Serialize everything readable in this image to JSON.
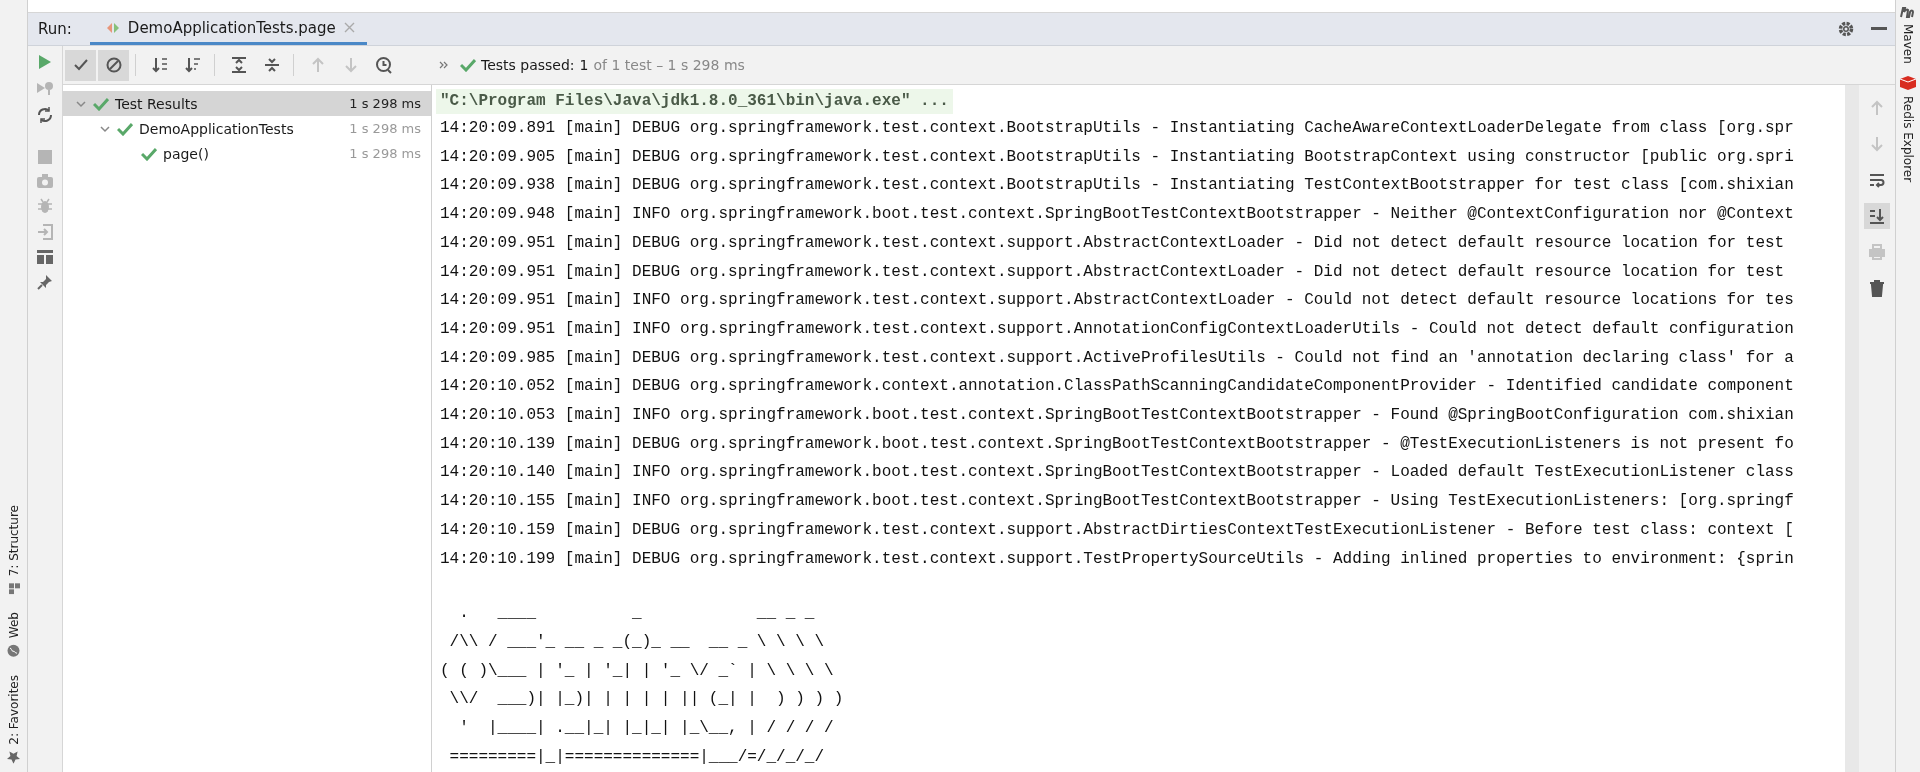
{
  "run_bar": {
    "label": "Run:",
    "tabs": [
      {
        "title": "DemoApplicationTests.page",
        "selected": true
      }
    ]
  },
  "toolbar": [
    {
      "kind": "show-passed",
      "on": true,
      "disabled": false
    },
    {
      "kind": "show-ignored",
      "on": true,
      "disabled": false
    },
    {
      "kind": "sort-alpha",
      "on": false,
      "disabled": false
    },
    {
      "kind": "sort-duration",
      "on": false,
      "disabled": false
    },
    {
      "kind": "expand-all",
      "on": false,
      "disabled": false
    },
    {
      "kind": "collapse-all",
      "on": false,
      "disabled": false
    },
    {
      "kind": "previous",
      "on": false,
      "disabled": true
    },
    {
      "kind": "next",
      "on": false,
      "disabled": true
    },
    {
      "kind": "history",
      "on": false,
      "disabled": false
    }
  ],
  "status": {
    "label": "Tests passed:",
    "count": "1",
    "detail": "of 1 test – 1 s 298 ms"
  },
  "tree": [
    {
      "name": "Test Results",
      "time": "1 s 298 ms",
      "passed": true,
      "selected": true,
      "expanded": true,
      "children": [
        {
          "name": "DemoApplicationTests",
          "time": "1 s 298 ms",
          "passed": true,
          "selected": false,
          "expanded": true,
          "children": [
            {
              "name": "page()",
              "time": "1 s 298 ms",
              "passed": true,
              "selected": false
            }
          ]
        }
      ]
    }
  ],
  "console": {
    "command": "\"C:\\Program Files\\Java\\jdk1.8.0_361\\bin\\java.exe\" ...",
    "lines": [
      "14:20:09.891 [main] DEBUG org.springframework.test.context.BootstrapUtils - Instantiating CacheAwareContextLoaderDelegate from class [org.spr",
      "14:20:09.905 [main] DEBUG org.springframework.test.context.BootstrapUtils - Instantiating BootstrapContext using constructor [public org.spri",
      "14:20:09.938 [main] DEBUG org.springframework.test.context.BootstrapUtils - Instantiating TestContextBootstrapper for test class [com.shixian",
      "14:20:09.948 [main] INFO org.springframework.boot.test.context.SpringBootTestContextBootstrapper - Neither @ContextConfiguration nor @Context",
      "14:20:09.951 [main] DEBUG org.springframework.test.context.support.AbstractContextLoader - Did not detect default resource location for test",
      "14:20:09.951 [main] DEBUG org.springframework.test.context.support.AbstractContextLoader - Did not detect default resource location for test",
      "14:20:09.951 [main] INFO org.springframework.test.context.support.AbstractContextLoader - Could not detect default resource locations for tes",
      "14:20:09.951 [main] INFO org.springframework.test.context.support.AnnotationConfigContextLoaderUtils - Could not detect default configuration",
      "14:20:09.985 [main] DEBUG org.springframework.test.context.support.ActiveProfilesUtils - Could not find an 'annotation declaring class' for a",
      "14:20:10.052 [main] DEBUG org.springframework.context.annotation.ClassPathScanningCandidateComponentProvider - Identified candidate component",
      "14:20:10.053 [main] INFO org.springframework.boot.test.context.SpringBootTestContextBootstrapper - Found @SpringBootConfiguration com.shixian",
      "14:20:10.139 [main] DEBUG org.springframework.boot.test.context.SpringBootTestContextBootstrapper - @TestExecutionListeners is not present fo",
      "14:20:10.140 [main] INFO org.springframework.boot.test.context.SpringBootTestContextBootstrapper - Loaded default TestExecutionListener class",
      "14:20:10.155 [main] INFO org.springframework.boot.test.context.SpringBootTestContextBootstrapper - Using TestExecutionListeners: [org.springf",
      "14:20:10.159 [main] DEBUG org.springframework.test.context.support.AbstractDirtiesContextTestExecutionListener - Before test class: context [",
      "14:20:10.199 [main] DEBUG org.springframework.test.context.support.TestPropertySourceUtils - Adding inlined properties to environment: {sprin"
    ],
    "banner": [
      "  .   ____          _            __ _ _",
      " /\\\\ / ___'_ __ _ _(_)_ __  __ _ \\ \\ \\ \\",
      "( ( )\\___ | '_ | '_| | '_ \\/ _` | \\ \\ \\ \\",
      " \\\\/  ___)| |_)| | | | | || (_| |  ) ) ) )",
      "  '  |____| .__|_| |_|_| |_\\__, | / / / /",
      " =========|_|==============|___/=/_/_/_/"
    ]
  },
  "console_tools": [
    {
      "kind": "up",
      "on": false,
      "disabled": true
    },
    {
      "kind": "down",
      "on": false,
      "disabled": true
    },
    {
      "kind": "soft-wrap",
      "on": false,
      "disabled": false
    },
    {
      "kind": "scroll-end",
      "on": true,
      "disabled": false
    },
    {
      "kind": "print",
      "on": false,
      "disabled": true
    },
    {
      "kind": "clear",
      "on": false,
      "disabled": false
    }
  ],
  "left_stripe": [
    {
      "kind": "structure",
      "label": "7: Structure"
    },
    {
      "kind": "web",
      "label": "Web"
    },
    {
      "kind": "favorites",
      "label": "2: Favorites"
    }
  ],
  "right_stripe": [
    {
      "kind": "maven",
      "label": "Maven"
    },
    {
      "kind": "redis",
      "label": "Redis Explorer"
    }
  ]
}
